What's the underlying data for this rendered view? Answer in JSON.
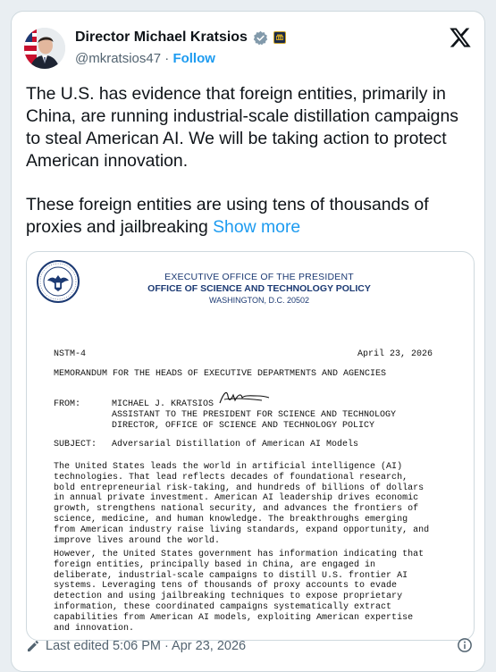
{
  "author": {
    "name": "Director Michael Kratsios",
    "handle": "@mkratsios47",
    "separator": "·",
    "follow_label": "Follow"
  },
  "icons": {
    "avatar": "profile-photo",
    "verified": "verified-badge-icon",
    "affiliation": "affiliation-badge-icon",
    "platform": "x-logo-icon",
    "edit": "pencil-icon",
    "info": "info-icon"
  },
  "colors": {
    "link": "#1d9bf0",
    "verified_badge": "#829aab",
    "letterhead": "#1c3a73"
  },
  "post": {
    "paragraph1": "The U.S. has evidence that foreign entities, primarily in China, are running industrial-scale distillation campaigns to steal American AI. We will be taking action to protect American innovation.",
    "paragraph2": "These foreign entities are using tens of thousands of proxies and jailbreaking",
    "show_more": "Show more"
  },
  "memo": {
    "office_line1": "EXECUTIVE OFFICE OF THE PRESIDENT",
    "office_line2": "OFFICE OF SCIENCE AND TECHNOLOGY POLICY",
    "office_line3": "WASHINGTON, D.C. 20502",
    "number": "NSTM-4",
    "date": "April 23, 2026",
    "memo_for": "MEMORANDUM FOR THE HEADS OF EXECUTIVE DEPARTMENTS AND AGENCIES",
    "from_label": "FROM:",
    "from_name": "MICHAEL J. KRATSIOS",
    "from_title1": "ASSISTANT TO THE PRESIDENT FOR SCIENCE AND TECHNOLOGY",
    "from_title2": "DIRECTOR, OFFICE OF SCIENCE AND TECHNOLOGY POLICY",
    "subject_label": "SUBJECT:",
    "subject": "Adversarial Distillation of American AI Models",
    "para1": "The United States leads the world in artificial intelligence (AI)\ntechnologies. That lead reflects decades of foundational research,\nbold entrepreneurial risk-taking, and hundreds of billions of dollars\nin annual private investment. American AI leadership drives economic\ngrowth, strengthens national security, and advances the frontiers of\nscience, medicine, and human knowledge. The breakthroughs emerging\nfrom American industry raise living standards, expand opportunity, and\nimprove lives around the world.",
    "para2": "However, the United States government has information indicating that\nforeign entities, principally based in China, are engaged in\ndeliberate, industrial-scale campaigns to distill U.S. frontier AI\nsystems. Leveraging tens of thousands of proxy accounts to evade\ndetection and using jailbreaking techniques to expose proprietary\ninformation, these coordinated campaigns systematically extract\ncapabilities from American AI models, exploiting American expertise\nand innovation."
  },
  "footer": {
    "last_edited": "Last edited 5:06 PM · Apr 23, 2026"
  }
}
